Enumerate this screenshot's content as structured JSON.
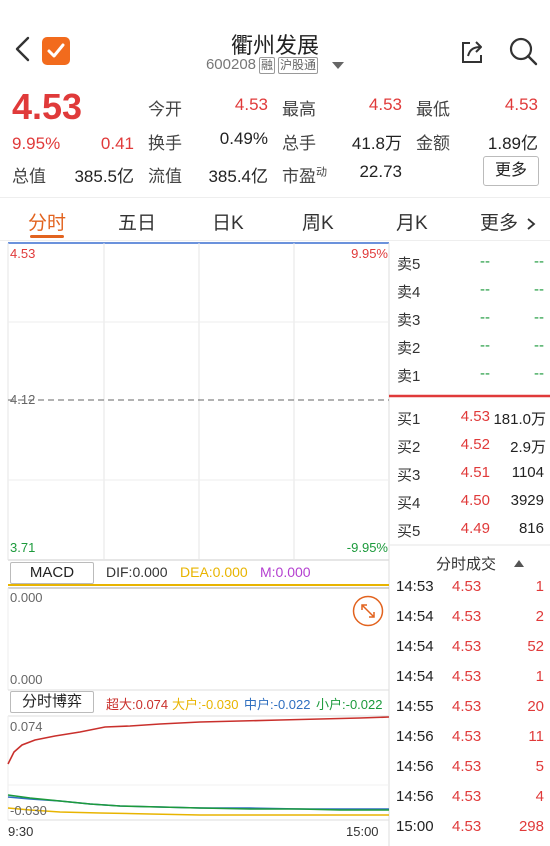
{
  "header": {
    "title": "衢州发展",
    "code": "600208",
    "tag_margin": "融",
    "tag_connect": "沪股通"
  },
  "quote": {
    "price": "4.53",
    "change_pct": "9.95%",
    "change": "0.41",
    "total_value_label": "总值",
    "total_value": "385.5亿",
    "open_label": "今开",
    "open": "4.53",
    "high_label": "最高",
    "high": "4.53",
    "low_label": "最低",
    "low": "4.53",
    "turnover_label": "换手",
    "turnover": "0.49%",
    "volume_label": "总手",
    "volume": "41.8万",
    "amount_label": "金额",
    "amount": "1.89亿",
    "float_value_label": "流值",
    "float_value": "385.4亿",
    "pe_label": "市盈",
    "pe_sup": "动",
    "pe": "22.73",
    "more_button": "更多"
  },
  "tabs": [
    "分时",
    "五日",
    "日K",
    "周K",
    "月K",
    "更多"
  ],
  "intraday": {
    "top_left": "4.53",
    "top_right": "9.95%",
    "mid_price": "4.12",
    "bottom_left": "3.71",
    "bottom_right": "-9.95%"
  },
  "macd": {
    "label": "MACD",
    "dif": "DIF:0.000",
    "dea": "DEA:0.000",
    "m": "M:0.000",
    "top_value": "0.000",
    "bottom_value": "0.000"
  },
  "flow": {
    "label": "分时博弈",
    "super": "超大:0.074",
    "large": "大户:-0.030",
    "mid": "中户:-0.022",
    "small": "小户:-0.022",
    "top_value": "0.074",
    "bottom_value": "-0.030",
    "time_start": "9:30",
    "time_end": "15:00"
  },
  "order_book": {
    "asks": [
      {
        "label": "卖5",
        "price": "--",
        "vol": "--"
      },
      {
        "label": "卖4",
        "price": "--",
        "vol": "--"
      },
      {
        "label": "卖3",
        "price": "--",
        "vol": "--"
      },
      {
        "label": "卖2",
        "price": "--",
        "vol": "--"
      },
      {
        "label": "卖1",
        "price": "--",
        "vol": "--"
      }
    ],
    "bids": [
      {
        "label": "买1",
        "price": "4.53",
        "vol": "181.0万"
      },
      {
        "label": "买2",
        "price": "4.52",
        "vol": "2.9万"
      },
      {
        "label": "买3",
        "price": "4.51",
        "vol": "1104"
      },
      {
        "label": "买4",
        "price": "4.50",
        "vol": "3929"
      },
      {
        "label": "买5",
        "price": "4.49",
        "vol": "816"
      }
    ]
  },
  "trades": {
    "header": "分时成交",
    "rows": [
      {
        "time": "14:53",
        "price": "4.53",
        "vol": "1"
      },
      {
        "time": "14:54",
        "price": "4.53",
        "vol": "2"
      },
      {
        "time": "14:54",
        "price": "4.53",
        "vol": "52"
      },
      {
        "time": "14:54",
        "price": "4.53",
        "vol": "1"
      },
      {
        "time": "14:55",
        "price": "4.53",
        "vol": "20"
      },
      {
        "time": "14:56",
        "price": "4.53",
        "vol": "11"
      },
      {
        "time": "14:56",
        "price": "4.53",
        "vol": "5"
      },
      {
        "time": "14:56",
        "price": "4.53",
        "vol": "4"
      },
      {
        "time": "15:00",
        "price": "4.53",
        "vol": "298"
      }
    ]
  },
  "colors": {
    "up": "#e03a3a",
    "down": "#1c9a3c",
    "accent": "#e2631f",
    "dea": "#e8b400",
    "m": "#b43fd0",
    "mid": "#2f6fc0"
  }
}
